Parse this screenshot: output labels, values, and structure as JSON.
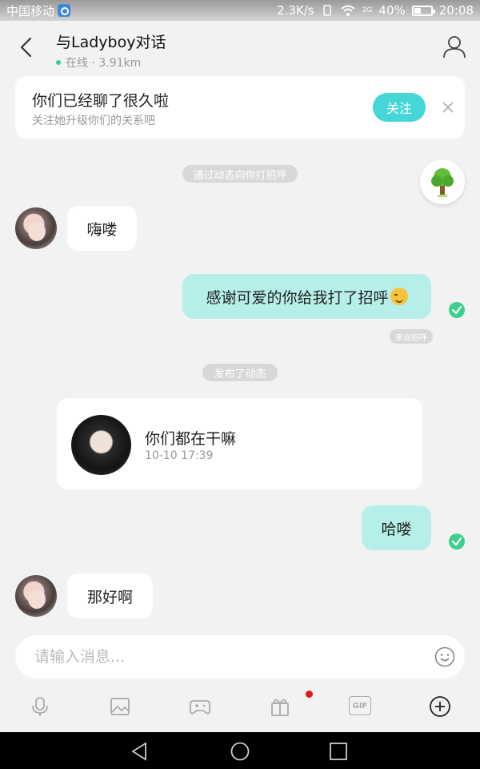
{
  "status_bar": {
    "carrier": "中国移动",
    "speed": "2.3K/s",
    "network": "2G",
    "battery": "40%",
    "time": "20:08"
  },
  "header": {
    "title": "与Ladyboy对话",
    "status": "在线 · 3.91km"
  },
  "follow_card": {
    "title": "你们已经聊了很久啦",
    "subtitle": "关注她升级你们的关系吧",
    "button": "关注"
  },
  "system": {
    "greeting_notice": "通过动态向你打招呼",
    "from_greeting": "来自招呼",
    "posted_moment": "发布了动态"
  },
  "messages": [
    {
      "side": "in",
      "text": "嗨喽"
    },
    {
      "side": "out",
      "text": "感谢可爱的你给我打了招呼"
    },
    {
      "side": "out",
      "text": "哈喽"
    },
    {
      "side": "in",
      "text": "那好啊"
    }
  ],
  "moment": {
    "text": "你们都在干嘛",
    "time": "10-10 17:39"
  },
  "input": {
    "placeholder": "请输入消息...",
    "value": ""
  },
  "toolbar": {
    "gif_label": "GIF"
  },
  "colors": {
    "accent": "#45d6d8",
    "outgoing_bubble": "#b6efea",
    "check": "#3ecf8e",
    "online": "#35d08c"
  }
}
